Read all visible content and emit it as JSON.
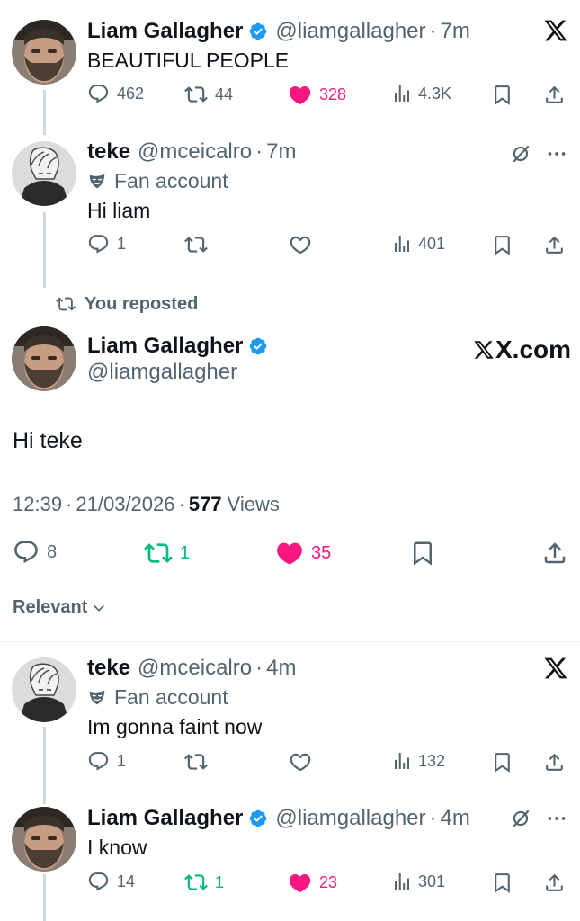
{
  "tweet1": {
    "name": "Liam Gallagher",
    "handle": "@liamgallagher",
    "time": "7m",
    "text": "BEAUTIFUL PEOPLE",
    "replies": "462",
    "reposts": "44",
    "likes": "328",
    "views": "4.3K"
  },
  "tweet2": {
    "name": "teke",
    "handle": "@mceicalro",
    "time": "7m",
    "fan_label": "Fan account",
    "text": "Hi liam",
    "replies": "1",
    "views": "401"
  },
  "repost_banner": "You reposted",
  "main": {
    "name": "Liam Gallagher",
    "handle": "@liamgallagher",
    "watermark": "X.com",
    "text": "Hi teke",
    "time": "12:39",
    "date": "21/03/2026",
    "views_count": "577",
    "views_label": "Views",
    "replies": "8",
    "reposts": "1",
    "likes": "35"
  },
  "sort_label": "Relevant",
  "reply1": {
    "name": "teke",
    "handle": "@mceicalro",
    "time": "4m",
    "fan_label": "Fan account",
    "text": "Im gonna faint now",
    "replies": "1",
    "views": "132"
  },
  "reply2": {
    "name": "Liam Gallagher",
    "handle": "@liamgallagher",
    "time": "4m",
    "text": "I know",
    "replies": "14",
    "reposts": "1",
    "likes": "23",
    "views": "301"
  },
  "dot": "·",
  "colors": {
    "like": "#f91880",
    "repost": "#00ba7c",
    "verified": "#1d9bf0",
    "secondary": "#536471"
  }
}
